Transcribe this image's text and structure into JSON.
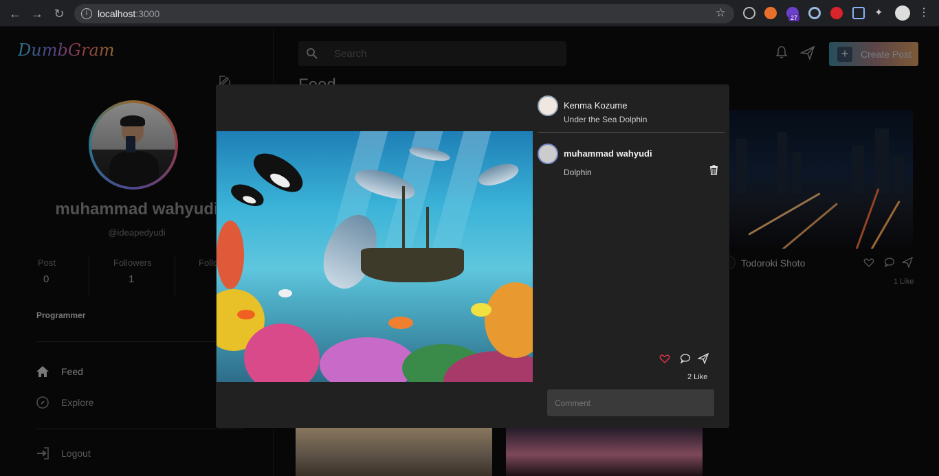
{
  "browser": {
    "url_host": "localhost",
    "url_port": ":3000",
    "ext_badge": "27"
  },
  "sidebar": {
    "logo": "DumbGram",
    "profile": {
      "name": "muhammad wahyudi",
      "handle": "@ideapedyudi",
      "bio": "Programmer"
    },
    "stats": [
      {
        "label": "Post",
        "value": "0"
      },
      {
        "label": "Followers",
        "value": "1"
      },
      {
        "label": "Following",
        "value": ""
      }
    ],
    "menu": [
      {
        "label": "Feed",
        "icon": "home-icon"
      },
      {
        "label": "Explore",
        "icon": "compass-icon"
      }
    ],
    "logout_label": "Logout"
  },
  "header": {
    "search_placeholder": "Search",
    "create_post_label": "Create Post"
  },
  "feed": {
    "title": "Feed",
    "card": {
      "author": "Todoroki Shoto",
      "likes": "1 Like"
    }
  },
  "modal": {
    "post_author": "Kenma Kozume",
    "post_caption": "Under the Sea Dolphin",
    "comments": [
      {
        "author": "muhammad wahyudi",
        "text": "Dolphin"
      }
    ],
    "likes": "2 Like",
    "comment_placeholder": "Comment",
    "colors": {
      "like": "#e0344a",
      "accent_gradient": [
        "#3b7a8e",
        "#c08a55"
      ]
    }
  }
}
